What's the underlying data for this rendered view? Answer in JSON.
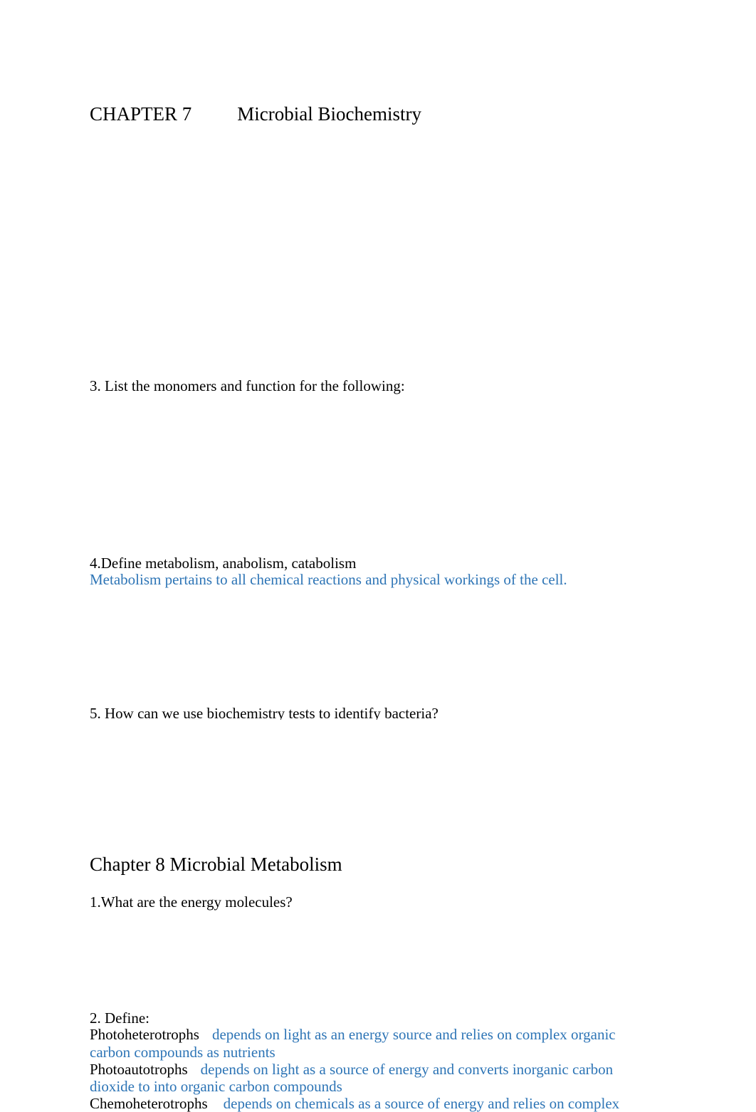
{
  "chapter7": {
    "label": "CHAPTER 7",
    "title": "Microbial Biochemistry",
    "q3": "3. List the monomers and function for the following:",
    "q4": "4.Define metabolism, anabolism, catabolism",
    "q4_answer": "Metabolism pertains to all chemical reactions and physical workings of the cell.",
    "q5": "5. How can we use biochemistry tests to identify bacteria?"
  },
  "chapter8": {
    "title": "Chapter 8 Microbial Metabolism",
    "q1": "1.What are the energy molecules?",
    "q2": "2. Define:",
    "definitions": [
      {
        "term": "Photoheterotrophs",
        "line1": "depends on light as an energy source and relies on complex organic",
        "line2": "carbon compounds as nutrients"
      },
      {
        "term": "Photoautotrophs",
        "line1": "depends on light as a source of energy and converts inorganic carbon",
        "line2": "dioxide to into organic carbon compounds"
      },
      {
        "term": "Chemoheterotrophs",
        "line1": "depends on chemicals as a source of energy and relies on complex"
      }
    ]
  },
  "colors": {
    "answer": "#2e75b6",
    "text": "#000000"
  }
}
